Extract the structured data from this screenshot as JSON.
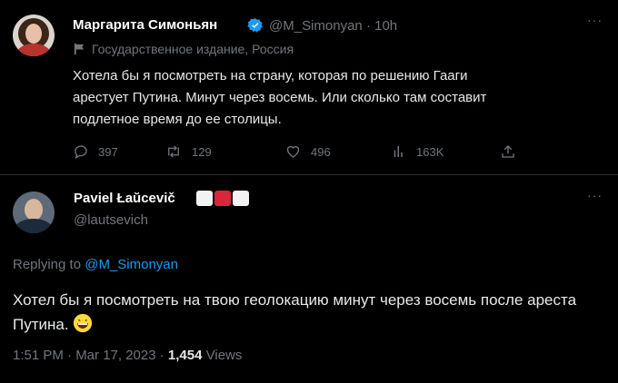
{
  "tweet": {
    "author_name": "Маргарита Симоньян",
    "handle": "@M_Simonyan",
    "time": "10h",
    "label": "Государственное издание, Россия",
    "text": "Хотела бы я посмотреть на страну, которая по решению Гааги арестует Путина. Минут через восемь. Или сколько там составит подлетное время до ее столицы.",
    "stats": {
      "replies": "397",
      "retweets": "129",
      "likes": "496",
      "views": "163K"
    },
    "more": "···"
  },
  "reply": {
    "author_name": "Pavіel Łaŭcevič",
    "handle": "@lautsevich",
    "replying_prefix": "Replying to ",
    "replying_to": "@M_Simonyan",
    "text": "Хотел бы я посмотреть на твою геолокацию минут через восемь после ареста Путина.",
    "datetime": "1:51 PM · Mar 17, 2023 · ",
    "views_count": "1,454",
    "views_label": " Views",
    "more": "···"
  },
  "colors": {
    "link": "#1d9bf0",
    "muted": "#71767b",
    "background": "#000000"
  }
}
